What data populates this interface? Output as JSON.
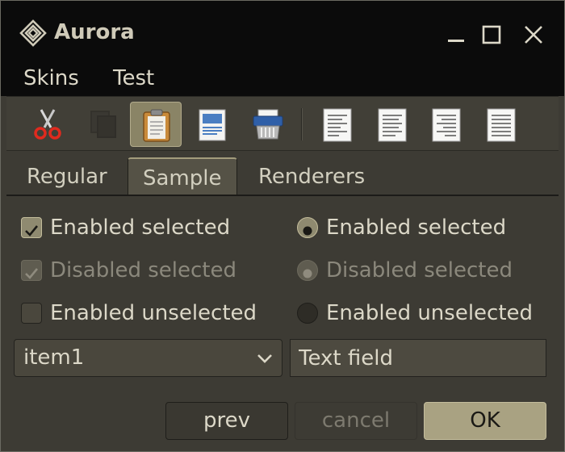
{
  "window": {
    "title": "Aurora",
    "controls": [
      "minimize-icon",
      "maximize-icon",
      "close-icon"
    ]
  },
  "menu": {
    "items": [
      "Skins",
      "Test"
    ]
  },
  "toolbar": {
    "icons": [
      "scissors-icon",
      "copy-icon",
      "clipboard-icon",
      "document-icon",
      "shredder-icon",
      "align-left-icon",
      "align-left-alt-icon",
      "align-right-icon",
      "justify-icon"
    ],
    "selected": "clipboard-icon"
  },
  "tabs": {
    "items": [
      "Regular",
      "Sample",
      "Renderers"
    ],
    "selected": "Sample"
  },
  "checkboxes": [
    {
      "label": "Enabled selected",
      "checked": true,
      "enabled": true
    },
    {
      "label": "Disabled selected",
      "checked": true,
      "enabled": false
    },
    {
      "label": "Enabled unselected",
      "checked": false,
      "enabled": true
    }
  ],
  "radios": [
    {
      "label": "Enabled selected",
      "checked": true,
      "enabled": true
    },
    {
      "label": "Disabled selected",
      "checked": true,
      "enabled": false
    },
    {
      "label": "Enabled unselected",
      "checked": false,
      "enabled": true
    }
  ],
  "combo": {
    "value": "item1"
  },
  "textfield": {
    "value": "Text field"
  },
  "buttons": {
    "prev": "prev",
    "cancel": "cancel",
    "ok": "OK"
  },
  "colors": {
    "window_bg": "#3d3b34",
    "titlebar_bg": "#0b0b0b",
    "accent": "#a9a282",
    "text": "#dcd8c8"
  }
}
